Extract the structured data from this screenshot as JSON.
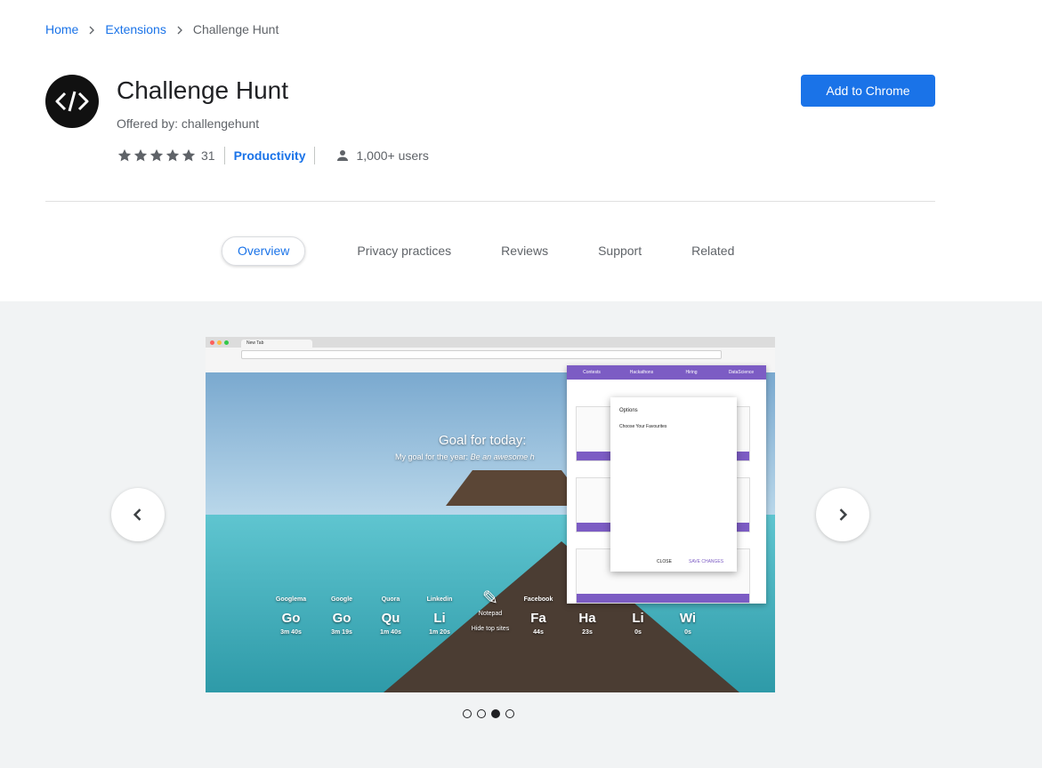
{
  "breadcrumb": {
    "home": "Home",
    "extensions": "Extensions",
    "current": "Challenge Hunt"
  },
  "extension": {
    "title": "Challenge Hunt",
    "offered_by": "Offered by: challengehunt",
    "rating_count": "31",
    "rating_stars": 5,
    "category": "Productivity",
    "users": "1,000+ users",
    "add_button": "Add to Chrome"
  },
  "tabs": [
    {
      "label": "Overview",
      "active": true
    },
    {
      "label": "Privacy practices",
      "active": false
    },
    {
      "label": "Reviews",
      "active": false
    },
    {
      "label": "Support",
      "active": false
    },
    {
      "label": "Related",
      "active": false
    }
  ],
  "gallery": {
    "slide_count": 4,
    "active_slide": 3,
    "prev_icon": "chevron-left-icon",
    "next_icon": "chevron-right-icon",
    "screenshot": {
      "tab_title": "New Tab",
      "goal_title": "Goal for today:",
      "goal_year_prefix": "My goal for the year:",
      "goal_year_value": "Be an awesome h",
      "panel_tabs": [
        "Contests",
        "Hackathons",
        "Hiring",
        "DataScience"
      ],
      "options_title": "Options",
      "options_subtitle": "Choose Your Favourites",
      "options_close": "CLOSE",
      "options_save": "SAVE CHANGES",
      "sites": [
        {
          "name": "Googlema",
          "abbr": "Go",
          "time": "3m 40s"
        },
        {
          "name": "Google",
          "abbr": "Go",
          "time": "3m 19s"
        },
        {
          "name": "Quora",
          "abbr": "Qu",
          "time": "1m 40s"
        },
        {
          "name": "Linkedin",
          "abbr": "Li",
          "time": "1m 20s"
        },
        {
          "name": "Facebook",
          "abbr": "Fa",
          "time": "44s"
        },
        {
          "name": "",
          "abbr": "Ha",
          "time": "23s"
        },
        {
          "name": "",
          "abbr": "Li",
          "time": "0s"
        },
        {
          "name": "",
          "abbr": "Wi",
          "time": "0s"
        }
      ],
      "notepad": "Notepad",
      "hide_top_sites": "Hide top sites"
    }
  },
  "colors": {
    "accent": "#1a73e8",
    "panel_purple": "#7c5cc4"
  }
}
